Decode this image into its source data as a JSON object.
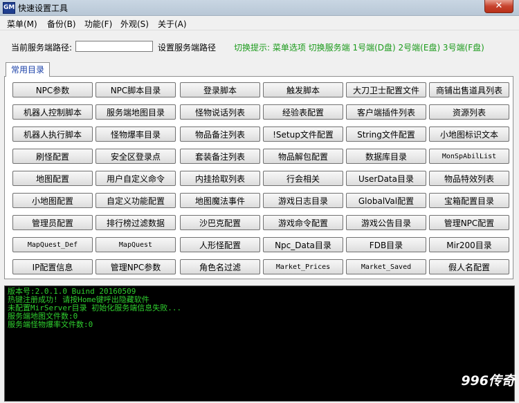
{
  "window": {
    "title": "快速设置工具",
    "icon_text": "GM",
    "close_label": "✕"
  },
  "menu": [
    {
      "label": "菜单(M)"
    },
    {
      "label": "备份(B)"
    },
    {
      "label": "功能(F)"
    },
    {
      "label": "外观(S)"
    },
    {
      "label": "关于(A)"
    }
  ],
  "path_bar": {
    "label": "当前服务端路径:",
    "value": "",
    "set_label": "设置服务端路径",
    "hint": "切换提示: 菜单选项 切换服务端 1号端(D盘) 2号端(E盘) 3号端(F盘)"
  },
  "tab": {
    "label": "常用目录"
  },
  "buttons": [
    [
      "NPC参数",
      "NPC脚本目录",
      "登录脚本",
      "触发脚本",
      "大刀卫士配置文件",
      "商铺出售道具列表"
    ],
    [
      "机器人控制脚本",
      "服务端地图目录",
      "怪物说话列表",
      "经验表配置",
      "客户端插件列表",
      "资源列表"
    ],
    [
      "机器人执行脚本",
      "怪物爆率目录",
      "物品备注列表",
      "!Setup文件配置",
      "String文件配置",
      "小地图标识文本"
    ],
    [
      "刷怪配置",
      "安全区登录点",
      "套装备注列表",
      "物品解包配置",
      "数据库目录",
      "MonSpAbilList"
    ],
    [
      "地图配置",
      "用户自定义命令",
      "内挂拾取列表",
      "行会相关",
      "UserData目录",
      "物品特效列表"
    ],
    [
      "小地图配置",
      "自定义功能配置",
      "地图魔法事件",
      "游戏日志目录",
      "GlobalVal配置",
      "宝箱配置目录"
    ],
    [
      "管理员配置",
      "排行榜过滤数据",
      "沙巴克配置",
      "游戏命令配置",
      "游戏公告目录",
      "管理NPC配置"
    ],
    [
      "MapQuest_Def",
      "MapQuest",
      "人形怪配置",
      "Npc_Data目录",
      "FDB目录",
      "Mir200目录"
    ],
    [
      "IP配置信息",
      "管理NPC参数",
      "角色名过滤",
      "Market_Prices",
      "Market_Saved",
      "假人名配置"
    ]
  ],
  "console": [
    "版本号:2.0.1.0 Buind 20160509",
    "热键注册成功! 请按Home键呼出隐藏软件",
    "未配置MirServer目录 初始化服务端信息失败...",
    "服务端地图文件数:0",
    "服务端怪物爆率文件数:0"
  ],
  "watermark": "996传奇"
}
